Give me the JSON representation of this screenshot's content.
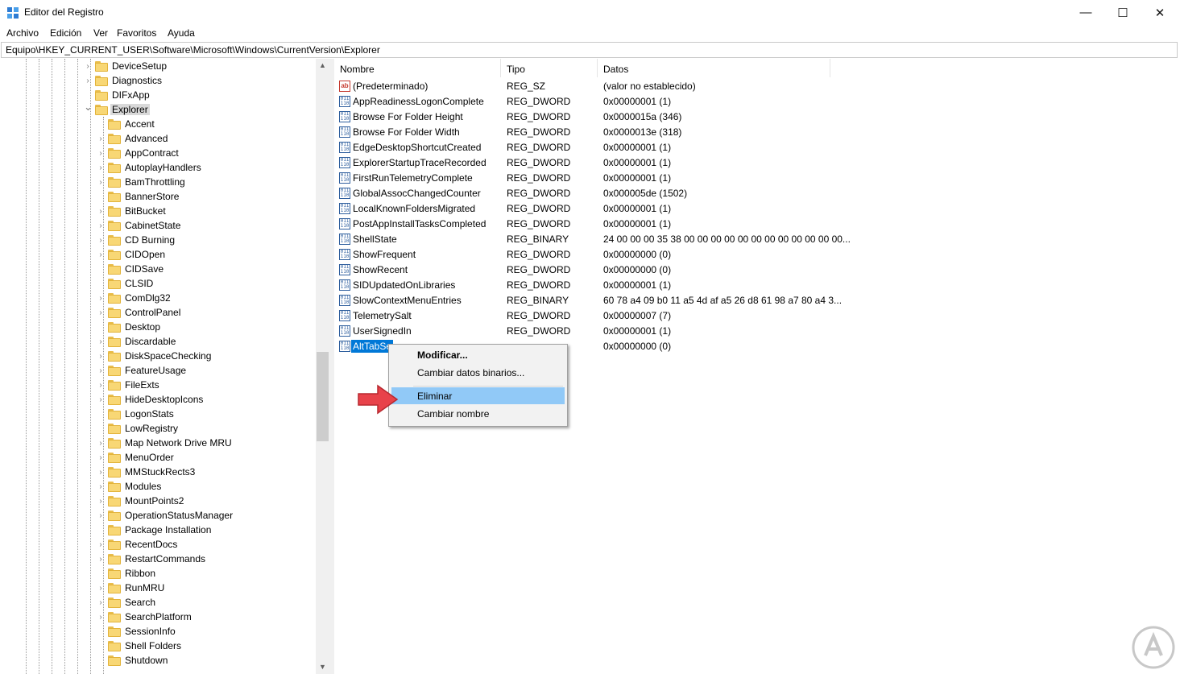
{
  "window": {
    "title": "Editor del Registro",
    "minimize_glyph": "—",
    "maximize_glyph": "☐",
    "close_glyph": "✕"
  },
  "menu": [
    "Archivo",
    "Edición",
    "Ver",
    "Favoritos",
    "Ayuda"
  ],
  "address": "Equipo\\HKEY_CURRENT_USER\\Software\\Microsoft\\Windows\\CurrentVersion\\Explorer",
  "tree": {
    "top_items": [
      {
        "label": "DeviceSetup",
        "expandable": true
      },
      {
        "label": "Diagnostics",
        "expandable": true
      },
      {
        "label": "DIFxApp",
        "expandable": false
      },
      {
        "label": "Explorer",
        "expandable": true,
        "expanded": true,
        "selected": true
      }
    ],
    "children": [
      "Accent",
      "Advanced",
      "AppContract",
      "AutoplayHandlers",
      "BamThrottling",
      "BannerStore",
      "BitBucket",
      "CabinetState",
      "CD Burning",
      "CIDOpen",
      "CIDSave",
      "CLSID",
      "ComDlg32",
      "ControlPanel",
      "Desktop",
      "Discardable",
      "DiskSpaceChecking",
      "FeatureUsage",
      "FileExts",
      "HideDesktopIcons",
      "LogonStats",
      "LowRegistry",
      "Map Network Drive MRU",
      "MenuOrder",
      "MMStuckRects3",
      "Modules",
      "MountPoints2",
      "OperationStatusManager",
      "Package Installation",
      "RecentDocs",
      "RestartCommands",
      "Ribbon",
      "RunMRU",
      "Search",
      "SearchPlatform",
      "SessionInfo",
      "Shell Folders",
      "Shutdown"
    ],
    "children_without_chevron": [
      "Accent",
      "BannerStore",
      "CIDSave",
      "CLSID",
      "Desktop",
      "LogonStats",
      "LowRegistry",
      "Package Installation",
      "Ribbon",
      "SessionInfo",
      "Shell Folders",
      "Shutdown"
    ]
  },
  "columns": {
    "name": "Nombre",
    "type": "Tipo",
    "data": "Datos"
  },
  "values": [
    {
      "icon": "string-value-icon",
      "icon_text": "ab",
      "name": "(Predeterminado)",
      "type": "REG_SZ",
      "data": "(valor no establecido)"
    },
    {
      "icon": "binary-value-icon",
      "icon_text": "011\n110",
      "name": "AppReadinessLogonComplete",
      "type": "REG_DWORD",
      "data": "0x00000001 (1)"
    },
    {
      "icon": "binary-value-icon",
      "icon_text": "011\n110",
      "name": "Browse For Folder Height",
      "type": "REG_DWORD",
      "data": "0x0000015a (346)"
    },
    {
      "icon": "binary-value-icon",
      "icon_text": "011\n110",
      "name": "Browse For Folder Width",
      "type": "REG_DWORD",
      "data": "0x0000013e (318)"
    },
    {
      "icon": "binary-value-icon",
      "icon_text": "011\n110",
      "name": "EdgeDesktopShortcutCreated",
      "type": "REG_DWORD",
      "data": "0x00000001 (1)"
    },
    {
      "icon": "binary-value-icon",
      "icon_text": "011\n110",
      "name": "ExplorerStartupTraceRecorded",
      "type": "REG_DWORD",
      "data": "0x00000001 (1)"
    },
    {
      "icon": "binary-value-icon",
      "icon_text": "011\n110",
      "name": "FirstRunTelemetryComplete",
      "type": "REG_DWORD",
      "data": "0x00000001 (1)"
    },
    {
      "icon": "binary-value-icon",
      "icon_text": "011\n110",
      "name": "GlobalAssocChangedCounter",
      "type": "REG_DWORD",
      "data": "0x000005de (1502)"
    },
    {
      "icon": "binary-value-icon",
      "icon_text": "011\n110",
      "name": "LocalKnownFoldersMigrated",
      "type": "REG_DWORD",
      "data": "0x00000001 (1)"
    },
    {
      "icon": "binary-value-icon",
      "icon_text": "011\n110",
      "name": "PostAppInstallTasksCompleted",
      "type": "REG_DWORD",
      "data": "0x00000001 (1)"
    },
    {
      "icon": "binary-value-icon",
      "icon_text": "011\n110",
      "name": "ShellState",
      "type": "REG_BINARY",
      "data": "24 00 00 00 35 38 00 00 00 00 00 00 00 00 00 00 00 00..."
    },
    {
      "icon": "binary-value-icon",
      "icon_text": "011\n110",
      "name": "ShowFrequent",
      "type": "REG_DWORD",
      "data": "0x00000000 (0)"
    },
    {
      "icon": "binary-value-icon",
      "icon_text": "011\n110",
      "name": "ShowRecent",
      "type": "REG_DWORD",
      "data": "0x00000000 (0)"
    },
    {
      "icon": "binary-value-icon",
      "icon_text": "011\n110",
      "name": "SIDUpdatedOnLibraries",
      "type": "REG_DWORD",
      "data": "0x00000001 (1)"
    },
    {
      "icon": "binary-value-icon",
      "icon_text": "011\n110",
      "name": "SlowContextMenuEntries",
      "type": "REG_BINARY",
      "data": "60 78 a4 09 b0 11 a5 4d af a5 26 d8 61 98 a7 80 a4 3..."
    },
    {
      "icon": "binary-value-icon",
      "icon_text": "011\n110",
      "name": "TelemetrySalt",
      "type": "REG_DWORD",
      "data": "0x00000007 (7)"
    },
    {
      "icon": "binary-value-icon",
      "icon_text": "011\n110",
      "name": "UserSignedIn",
      "type": "REG_DWORD",
      "data": "0x00000001 (1)"
    },
    {
      "icon": "binary-value-icon",
      "icon_text": "011\n110",
      "name": "AltTabSe",
      "type": "",
      "data": "0x00000000 (0)",
      "selected": true
    }
  ],
  "context_menu": {
    "items": [
      {
        "label": "Modificar...",
        "bold": true
      },
      {
        "label": "Cambiar datos binarios..."
      },
      {
        "label": "Eliminar",
        "highlighted": true
      },
      {
        "label": "Cambiar nombre"
      }
    ]
  },
  "colors": {
    "selection": "#0078d7",
    "menu_highlight": "#91c9f7",
    "arrow": "#e8424a",
    "tree_selection": "#d9d9d9"
  }
}
